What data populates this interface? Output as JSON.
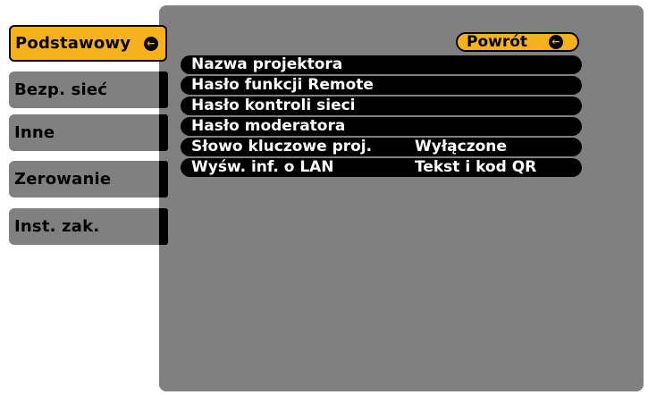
{
  "tabs": [
    {
      "label": "Podstawowy",
      "selected": true
    },
    {
      "label": "Bezp. sieć",
      "selected": false
    },
    {
      "label": "Inne",
      "selected": false
    },
    {
      "label": "Zerowanie",
      "selected": false
    },
    {
      "label": "Inst. zak.",
      "selected": false
    }
  ],
  "back_button": {
    "label": "Powrót"
  },
  "enter_icon": "enter-icon",
  "menu": [
    {
      "label": "Nazwa projektora",
      "value": ""
    },
    {
      "label": "Hasło funkcji Remote",
      "value": ""
    },
    {
      "label": "Hasło kontroli sieci",
      "value": ""
    },
    {
      "label": "Hasło moderatora",
      "value": ""
    },
    {
      "label": "Słowo kluczowe proj.",
      "value": "Wyłączone"
    },
    {
      "label": "Wyśw. inf. o LAN",
      "value": "Tekst i kod QR"
    }
  ],
  "colors": {
    "accent": "#f6b11d",
    "panel": "#808080",
    "item": "#000000"
  }
}
